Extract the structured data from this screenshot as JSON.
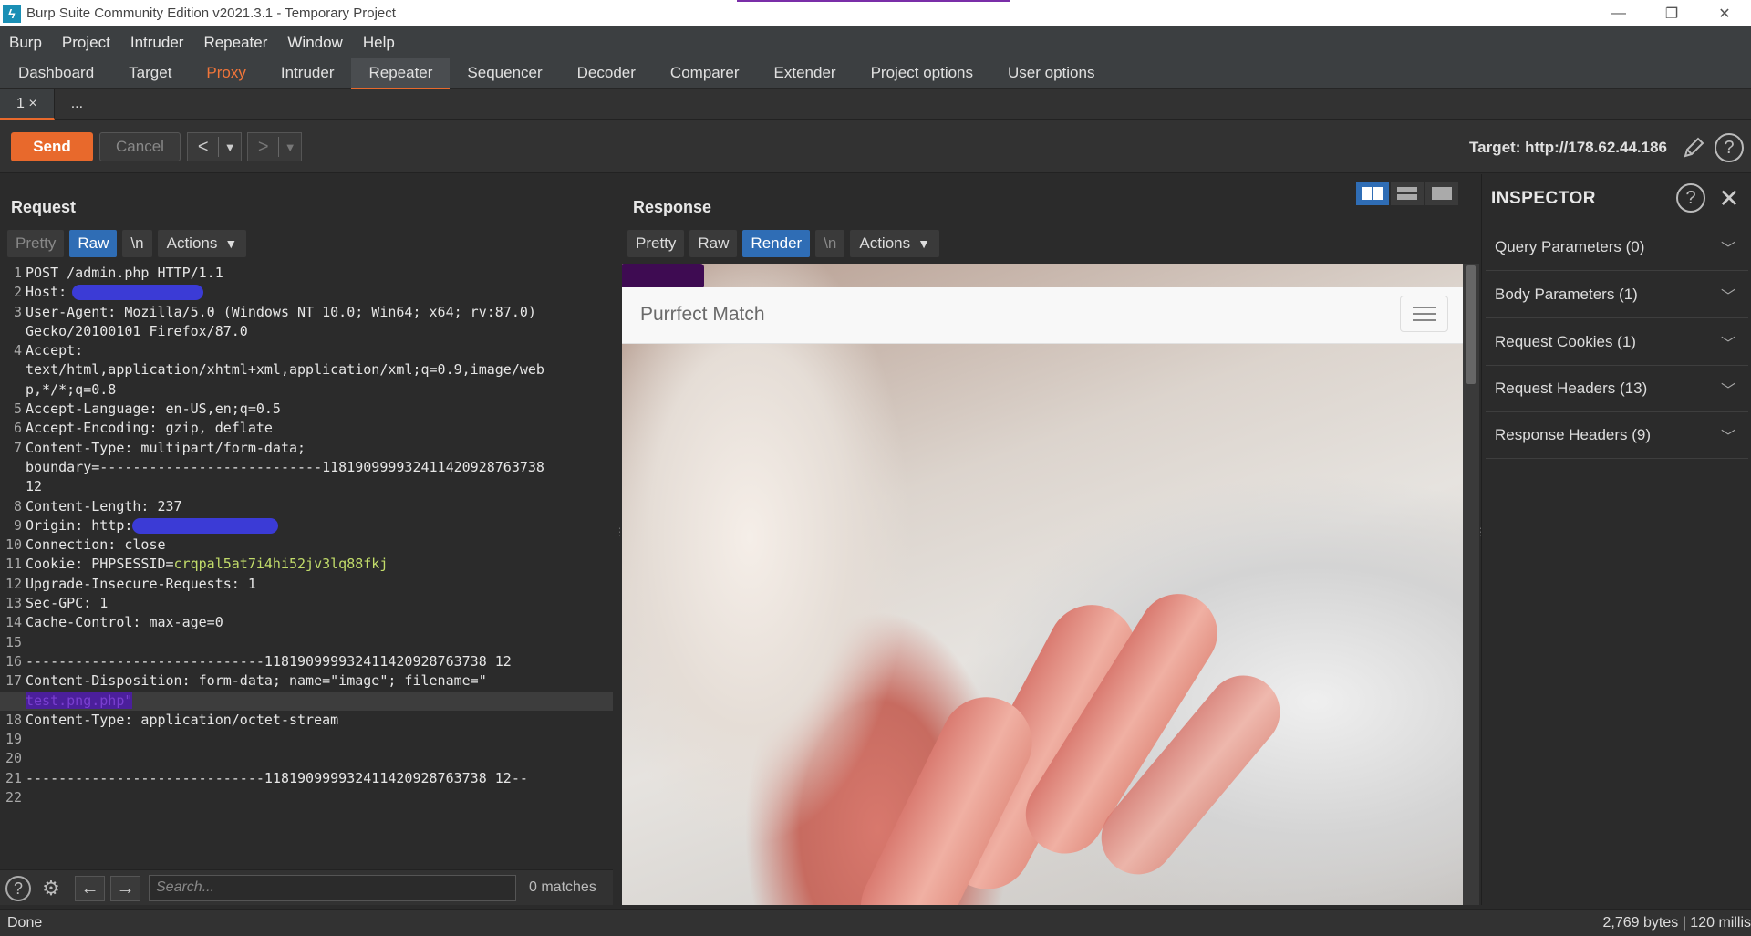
{
  "window": {
    "title": "Burp Suite Community Edition v2021.3.1 - Temporary Project",
    "minimize": "—",
    "restore": "❐",
    "close": "✕"
  },
  "menu": [
    "Burp",
    "Project",
    "Intruder",
    "Repeater",
    "Window",
    "Help"
  ],
  "main_tabs": [
    "Dashboard",
    "Target",
    "Proxy",
    "Intruder",
    "Repeater",
    "Sequencer",
    "Decoder",
    "Comparer",
    "Extender",
    "Project options",
    "User options"
  ],
  "active_main_tab": "Repeater",
  "sub_tabs": {
    "tab1": "1 ×",
    "more": "..."
  },
  "toolbar": {
    "send": "Send",
    "cancel": "Cancel",
    "target": "Target: http://178.62.44.186"
  },
  "request": {
    "title": "Request",
    "view": {
      "pretty": "Pretty",
      "raw": "Raw",
      "newline": "\\n",
      "actions": "Actions"
    },
    "lines": [
      {
        "n": "1",
        "text": "POST /admin.php HTTP/1.1"
      },
      {
        "n": "2",
        "key": "Host:",
        "redacted": true
      },
      {
        "n": "3",
        "key": "User-Agent:",
        "text": " Mozilla/5.0 (Windows NT 10.0; Win64; x64; rv:87.0)"
      },
      {
        "n": "",
        "text": "Gecko/20100101 Firefox/87.0"
      },
      {
        "n": "4",
        "key": "Accept:"
      },
      {
        "n": "",
        "text": "text/html,application/xhtml+xml,application/xml;q=0.9,image/web"
      },
      {
        "n": "",
        "text": "p,*/*;q=0.8"
      },
      {
        "n": "5",
        "key": "Accept-Language:",
        "text": " en-US,en;q=0.5"
      },
      {
        "n": "6",
        "key": "Accept-Encoding:",
        "text": " gzip, deflate"
      },
      {
        "n": "7",
        "key": "Content-Type:",
        "text": " multipart/form-data;"
      },
      {
        "n": "",
        "text": "boundary=---------------------------118190999932411420928763738"
      },
      {
        "n": "",
        "text": "12"
      },
      {
        "n": "8",
        "key": "Content-Length:",
        "text": " 237"
      },
      {
        "n": "9",
        "key": "Origin:",
        "text": " http:",
        "redacted": true
      },
      {
        "n": "10",
        "key": "Connection:",
        "text": " close"
      },
      {
        "n": "11",
        "key": "Cookie:",
        "text": " PHPSESSID=",
        "cookie": "crqpal5at7i4hi52jv3lq88fkj"
      },
      {
        "n": "12",
        "key": "Upgrade-Insecure-Requests:",
        "text": " 1"
      },
      {
        "n": "13",
        "key": "Sec-GPC:",
        "text": " 1"
      },
      {
        "n": "14",
        "key": "Cache-Control:",
        "text": " max-age=0"
      },
      {
        "n": "15",
        "text": ""
      },
      {
        "n": "16",
        "text": "-----------------------------118190999932411420928763738 12"
      },
      {
        "n": "17",
        "key": "Content-Disposition:",
        "text": " form-data; name=\"image\"; filename=\""
      },
      {
        "n": "",
        "purple": "test.png.php\"",
        "highlight": true
      },
      {
        "n": "18",
        "key": "Content-Type:",
        "text": " application/octet-stream"
      },
      {
        "n": "19",
        "text": ""
      },
      {
        "n": "20",
        "text": ""
      },
      {
        "n": "21",
        "text": "-----------------------------118190999932411420928763738 12--"
      },
      {
        "n": "22",
        "text": ""
      }
    ]
  },
  "search": {
    "placeholder": "Search...",
    "matches": "0 matches"
  },
  "response": {
    "title": "Response",
    "view": {
      "pretty": "Pretty",
      "raw": "Raw",
      "render": "Render",
      "newline": "\\n",
      "actions": "Actions"
    },
    "site_brand": "Purrfect Match"
  },
  "inspector": {
    "title": "INSPECTOR",
    "items": [
      "Query Parameters (0)",
      "Body Parameters (1)",
      "Request Cookies (1)",
      "Request Headers (13)",
      "Response Headers (9)"
    ]
  },
  "status": {
    "left": "Done",
    "right": "2,769 bytes | 120 millis"
  },
  "colors": {
    "accent": "#e8692c",
    "active_view": "#2f6db5",
    "cookie_value": "#c2dc6a"
  }
}
